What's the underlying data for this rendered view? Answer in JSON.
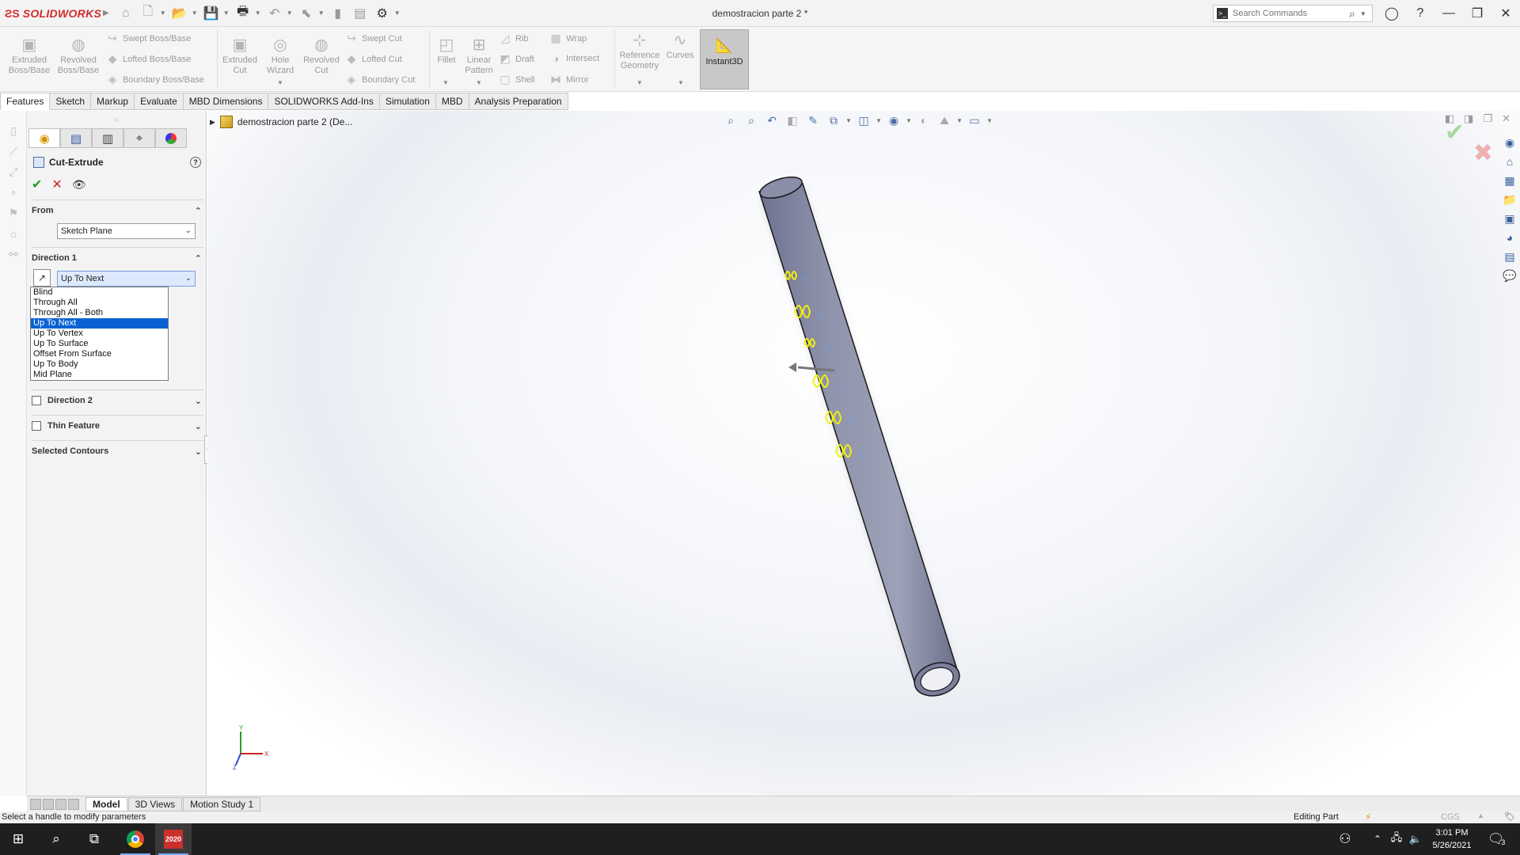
{
  "app": {
    "brand": "SOLIDWORKS",
    "document_title": "demostracion parte 2 *",
    "search_placeholder": "Search Commands"
  },
  "toolbar": {
    "extruded_boss": "Extruded Boss/Base",
    "revolved_boss": "Revolved Boss/Base",
    "swept_boss": "Swept Boss/Base",
    "lofted_boss": "Lofted Boss/Base",
    "boundary_boss": "Boundary Boss/Base",
    "extruded_cut": "Extruded Cut",
    "hole_wizard": "Hole Wizard",
    "revolved_cut": "Revolved Cut",
    "swept_cut": "Swept Cut",
    "lofted_cut": "Lofted Cut",
    "boundary_cut": "Boundary Cut",
    "fillet": "Fillet",
    "linear_pattern": "Linear Pattern",
    "rib": "Rib",
    "draft": "Draft",
    "shell": "Shell",
    "wrap": "Wrap",
    "intersect": "Intersect",
    "mirror": "Mirror",
    "reference_geometry": "Reference Geometry",
    "curves": "Curves",
    "instant3d": "Instant3D"
  },
  "tabs": [
    "Features",
    "Sketch",
    "Markup",
    "Evaluate",
    "MBD Dimensions",
    "SOLIDWORKS Add-Ins",
    "Simulation",
    "MBD",
    "Analysis Preparation"
  ],
  "property_manager": {
    "title": "Cut-Extrude",
    "from_label": "From",
    "from_value": "Sketch Plane",
    "direction1_label": "Direction 1",
    "direction1_value": "Up To Next",
    "end_conditions": [
      "Blind",
      "Through All",
      "Through All - Both",
      "Up To Next",
      "Up To Vertex",
      "Up To Surface",
      "Offset From Surface",
      "Up To Body",
      "Mid Plane"
    ],
    "selected_index": 3,
    "direction2_label": "Direction 2",
    "thin_feature_label": "Thin Feature",
    "selected_contours_label": "Selected Contours"
  },
  "tree": {
    "root_label": "demostracion parte 2  (De..."
  },
  "bottom_tabs": [
    "Model",
    "3D Views",
    "Motion Study 1"
  ],
  "status": {
    "message": "Select a handle to modify parameters",
    "mode": "Editing Part",
    "units": "CGS"
  },
  "taskbar": {
    "time": "3:01 PM",
    "date": "5/26/2021",
    "sw_badge": "2020",
    "notification_count": "3"
  },
  "colors": {
    "brand_red": "#d42a2a",
    "selection_blue": "#0a62d2",
    "tube_gray": "#8a8ea6",
    "sketch_yellow": "#f2f20a"
  }
}
